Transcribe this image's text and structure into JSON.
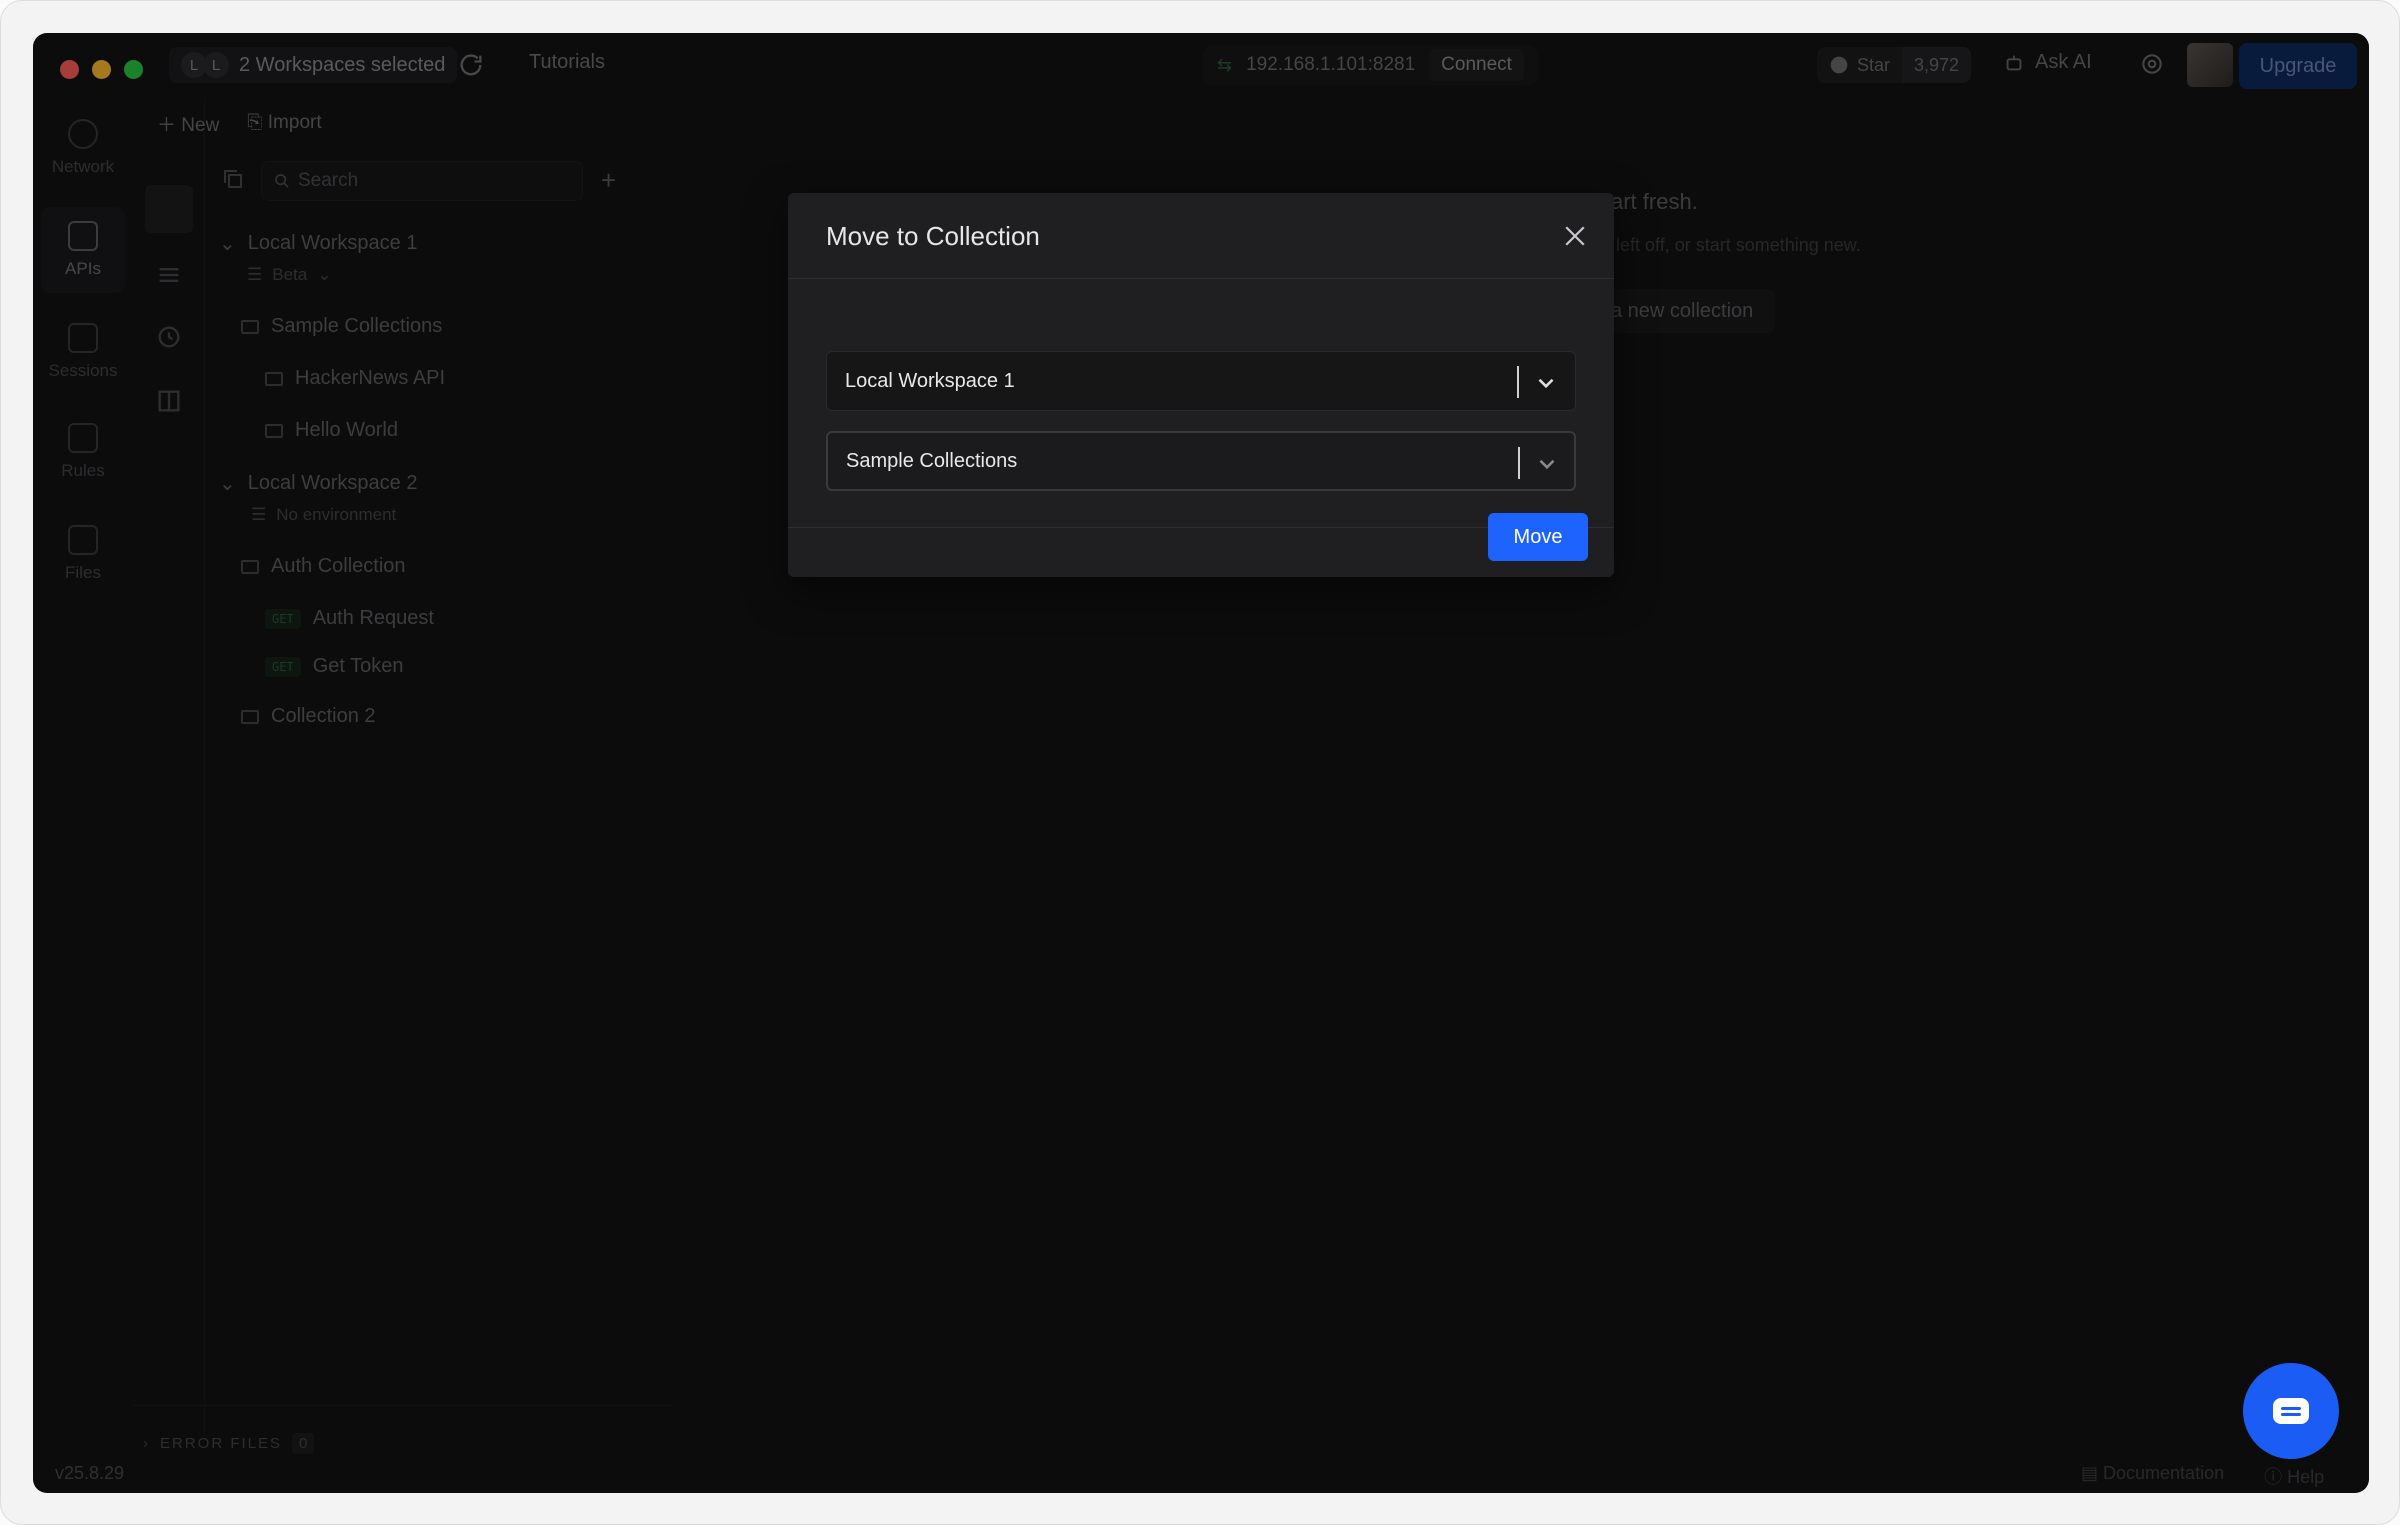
{
  "titlebar": {
    "workspace_initials_1": "L",
    "workspace_initials_2": "L",
    "workspace_label": "2 Workspaces selected",
    "tutorials": "Tutorials",
    "ip_address": "192.168.1.101:8281",
    "connect": "Connect",
    "star_label": "Star",
    "star_count": "3,972",
    "ask_ai": "Ask AI",
    "upgrade": "Upgrade"
  },
  "rail": {
    "items": [
      {
        "label": "Network",
        "icon": "globe-icon"
      },
      {
        "label": "APIs",
        "icon": "api-icon"
      },
      {
        "label": "Sessions",
        "icon": "sessions-icon"
      },
      {
        "label": "Rules",
        "icon": "rules-icon"
      },
      {
        "label": "Files",
        "icon": "files-icon"
      }
    ]
  },
  "sidebar": {
    "new_label": "New",
    "import_label": "Import",
    "search_placeholder": "Search",
    "workspace1": {
      "name": "Local Workspace 1",
      "env": "Beta",
      "collection": "Sample Collections",
      "children": [
        "HackerNews API",
        "Hello World"
      ]
    },
    "workspace2": {
      "name": "Local Workspace 2",
      "env": "No environment",
      "collection": "Auth Collection",
      "requests": [
        {
          "method": "GET",
          "name": "Auth Request"
        },
        {
          "method": "GET",
          "name": "Get Token"
        }
      ],
      "collection2": "Collection 2"
    },
    "error_files_label": "ERROR FILES",
    "error_files_count": "0"
  },
  "background": {
    "heading": "art fresh.",
    "sub": "u left off, or start something new.",
    "button": "a new collection"
  },
  "footer": {
    "version": "v25.8.29",
    "documentation": "Documentation",
    "help": "Help"
  },
  "modal": {
    "title": "Move to Collection",
    "workspace_value": "Local Workspace 1",
    "collection_value": "Sample Collections",
    "move_button": "Move"
  },
  "colors": {
    "accent": "#1f63ff",
    "modal_bg": "#1f1f21",
    "window_bg": "#131314"
  }
}
